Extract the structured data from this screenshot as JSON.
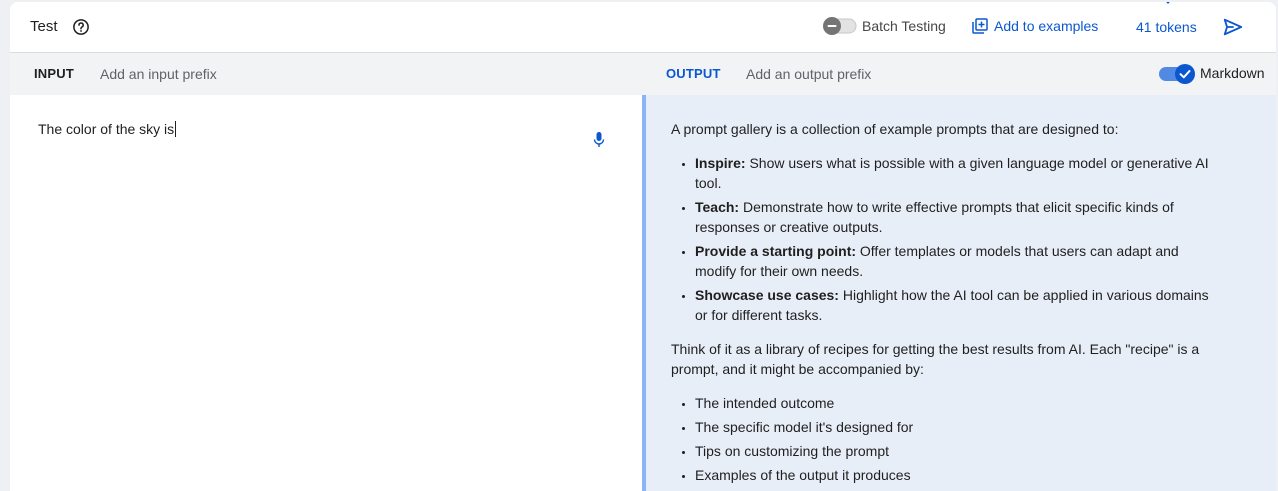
{
  "header": {
    "title": "Test",
    "batch_testing_label": "Batch Testing",
    "batch_testing_on": false,
    "add_to_examples_label": "Add to examples",
    "tokens_label": "41 tokens"
  },
  "prefix_bar": {
    "input_label": "INPUT",
    "input_prefix_placeholder": "Add an input prefix",
    "output_label": "OUTPUT",
    "output_prefix_placeholder": "Add an output prefix",
    "markdown_label": "Markdown",
    "markdown_on": true
  },
  "input": {
    "text": "The color of the sky is"
  },
  "output": {
    "intro": "A prompt gallery is a collection of example prompts that are designed to:",
    "goals": [
      {
        "term": "Inspire:",
        "text": " Show users what is possible with a given language model or generative AI tool."
      },
      {
        "term": "Teach:",
        "text": " Demonstrate how to write effective prompts that elicit specific kinds of responses or creative outputs."
      },
      {
        "term": "Provide a starting point:",
        "text": " Offer templates or models that users can adapt and modify for their own needs."
      },
      {
        "term": "Showcase use cases:",
        "text": " Highlight how the AI tool can be applied in various domains or for different tasks."
      }
    ],
    "paragraph2": "Think of it as a library of recipes for getting the best results from AI. Each \"recipe\" is a prompt, and it might be accompanied by:",
    "accompaniments": [
      "The intended outcome",
      "The specific model it's designed for",
      "Tips on customizing the prompt",
      "Examples of the output it produces"
    ]
  },
  "colors": {
    "accent": "#0b57d0",
    "output_bg": "#e8eef8",
    "output_border": "#8ab4f8",
    "bar_bg": "#f1f3f4"
  }
}
